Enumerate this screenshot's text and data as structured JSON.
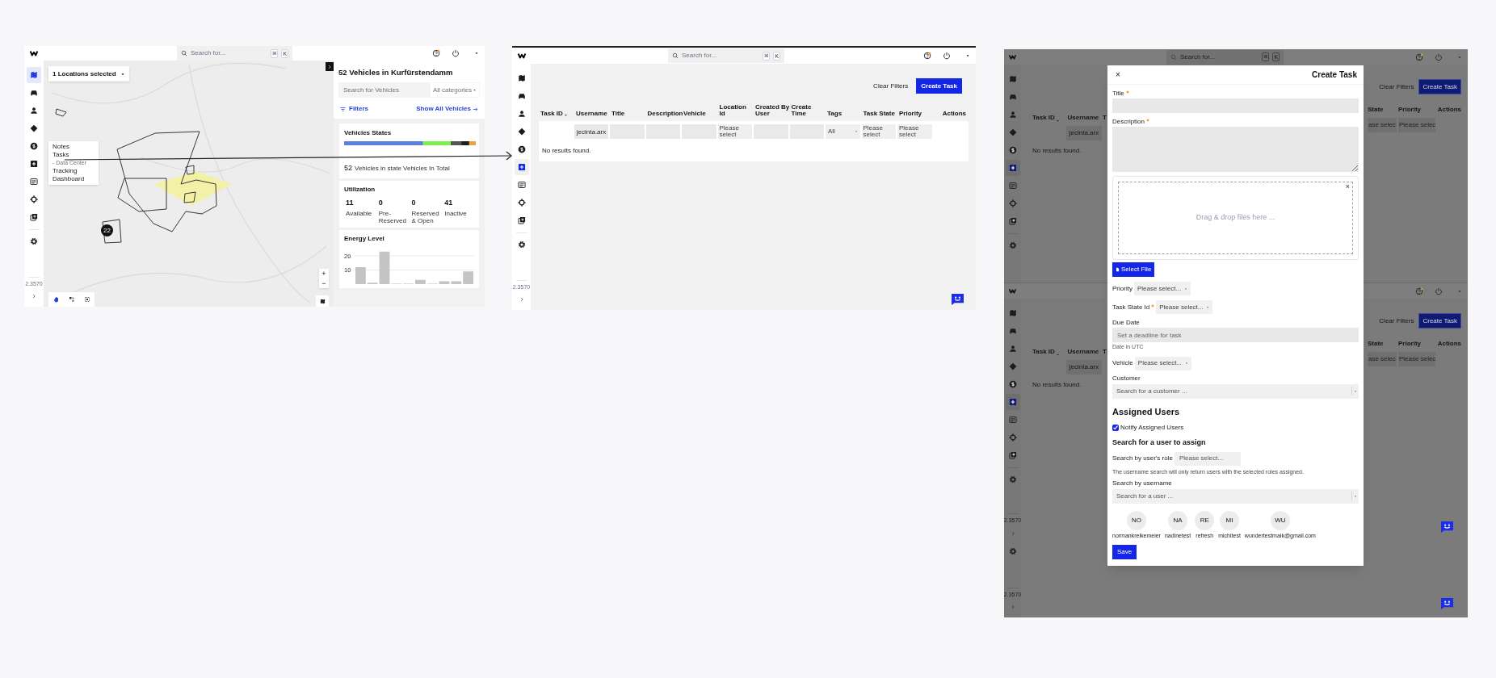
{
  "overview": {
    "header": {
      "search_placeholder": "Search for...",
      "shortcut": [
        "⌘",
        "K"
      ]
    },
    "nav": [
      {
        "selected": true
      },
      {
        "selected": false
      },
      {
        "selected": false
      },
      {
        "selected": false
      },
      {
        "selected": false
      },
      {
        "selected": false
      },
      {
        "selected": false
      },
      {
        "selected": false
      },
      {
        "selected": false
      }
    ],
    "version": "2.3570",
    "map": {
      "location_select": "1 Locations selected",
      "cluster": "22",
      "zoom_in": "+",
      "zoom_out": "−",
      "menu": [
        {
          "label": "Notes",
          "kind": "item"
        },
        {
          "label": "Tasks",
          "kind": "item"
        },
        {
          "label": "- Data Center",
          "kind": "sub"
        },
        {
          "label": "Tracking",
          "kind": "item"
        },
        {
          "label": "Dashboard",
          "kind": "item"
        }
      ]
    },
    "panel": {
      "title": "52 Vehicles in Kurfürstendamm",
      "search_placeholder": "Search for Vehicles",
      "category": "All categories",
      "filters": "Filters",
      "show_all": "Show All Vehicles",
      "states": {
        "title": "Vehicles States",
        "count": "52",
        "caption": "Vehicles in state Vehicles In Total"
      },
      "utilization": {
        "title": "Utilization",
        "stats": [
          {
            "value": "11",
            "label": "Available"
          },
          {
            "value": "0",
            "label": "Pre-Reserved"
          },
          {
            "value": "0",
            "label": "Reserved & Open"
          },
          {
            "value": "41",
            "label": "Inactive"
          }
        ]
      },
      "energy": {
        "chart_data": {
          "type": "bar",
          "title": "Energy Level",
          "values": [
            12,
            1,
            23,
            0,
            0,
            3,
            0,
            2,
            2,
            9
          ],
          "ylim": [
            0,
            24
          ],
          "yticks": [
            10,
            20
          ]
        }
      }
    }
  },
  "tasks": {
    "header": {
      "search_placeholder": "Search for...",
      "shortcut": [
        "⌘",
        "K"
      ]
    },
    "nav": [
      {
        "selected": false
      },
      {
        "selected": false
      },
      {
        "selected": false
      },
      {
        "selected": false
      },
      {
        "selected": false
      },
      {
        "selected": true
      },
      {
        "selected": false
      },
      {
        "selected": false
      },
      {
        "selected": false
      }
    ],
    "version": "2.3570",
    "buttons": {
      "clear": "Clear Filters",
      "create": "Create Task"
    },
    "columns": [
      {
        "label": "Task ID",
        "sorted": true
      },
      {
        "label": "Username",
        "sorted": false
      },
      {
        "label": "Title",
        "sorted": false
      },
      {
        "label": "Description",
        "sorted": false
      },
      {
        "label": "Vehicle",
        "sorted": false
      },
      {
        "label": "Location Id",
        "sorted": false
      },
      {
        "label": "Created By User",
        "sorted": false
      },
      {
        "label": "Create Time",
        "sorted": false
      },
      {
        "label": "Tags",
        "sorted": false
      },
      {
        "label": "Task State",
        "sorted": false
      },
      {
        "label": "Priority",
        "sorted": false
      },
      {
        "label": "Actions",
        "sorted": false
      }
    ],
    "filters": [
      {
        "kind": "none"
      },
      {
        "kind": "input",
        "value": "jecinta.arx"
      },
      {
        "kind": "input"
      },
      {
        "kind": "input"
      },
      {
        "kind": "input"
      },
      {
        "kind": "select",
        "placeholder": "Please select"
      },
      {
        "kind": "input"
      },
      {
        "kind": "input"
      },
      {
        "kind": "dropdown",
        "value": "All"
      },
      {
        "kind": "select",
        "placeholder": "Please select"
      },
      {
        "kind": "select",
        "placeholder": "Please select"
      },
      {
        "kind": "none"
      }
    ],
    "empty_text": "No results found."
  },
  "create_task": {
    "screens": [
      {
        "search_placeholder": "Search for...",
        "shortcut": [
          "⌘",
          "K"
        ],
        "nav": [
          {
            "selected": false
          },
          {
            "selected": false
          },
          {
            "selected": false
          },
          {
            "selected": false
          },
          {
            "selected": false
          },
          {
            "selected": true
          },
          {
            "selected": false
          },
          {
            "selected": false
          },
          {
            "selected": false
          }
        ],
        "buttons": {
          "clear": "Clear Filters",
          "create": "Create Task"
        },
        "left_columns": [
          {
            "label": "Task ID",
            "sorted": true
          },
          {
            "label": "Username",
            "sorted": false
          },
          {
            "label": "T",
            "sorted": false
          }
        ],
        "right_columns": [
          {
            "label": "State",
            "sorted": false
          },
          {
            "label": "Priority",
            "sorted": false
          },
          {
            "label": "Actions",
            "sorted": false
          }
        ],
        "left_cells": [
          "jecinta.arx"
        ],
        "right_cells": [
          "ase selec",
          "Please selec"
        ],
        "empty_text": "No results found."
      },
      {
        "nav": [
          {
            "selected": false
          },
          {
            "selected": false
          },
          {
            "selected": false
          },
          {
            "selected": false
          },
          {
            "selected": false
          },
          {
            "selected": true
          },
          {
            "selected": false
          },
          {
            "selected": false
          },
          {
            "selected": false
          }
        ],
        "versions": [
          "2.3570",
          "2.3570"
        ],
        "buttons": {
          "clear": "Clear Filters",
          "create": "Create Task"
        },
        "left_columns": [
          {
            "label": "Task ID",
            "sorted": true
          },
          {
            "label": "Username",
            "sorted": false
          },
          {
            "label": "T",
            "sorted": false
          }
        ],
        "right_columns": [
          {
            "label": "State",
            "sorted": false
          },
          {
            "label": "Priority",
            "sorted": false
          },
          {
            "label": "Actions",
            "sorted": false
          }
        ],
        "left_cells": [
          "jecinta.arx"
        ],
        "right_cells": [
          "ase selec",
          "Please selec"
        ],
        "empty_text": "No results found."
      }
    ],
    "modal": {
      "title": "Create Task",
      "close": "×",
      "items": [
        {
          "kind": "input",
          "label": "Title",
          "required": true
        },
        {
          "kind": "textarea",
          "label": "Description",
          "required": true
        },
        {
          "kind": "dropzone",
          "text": "Drag & drop files here ...",
          "close": "×"
        },
        {
          "kind": "file_button",
          "label": "Select File"
        },
        {
          "kind": "select",
          "label": "Priority",
          "required": false,
          "value": "Please select..."
        },
        {
          "kind": "select",
          "label": "Task State Id",
          "required": true,
          "value": "Please select..."
        },
        {
          "kind": "date",
          "label": "Due Date",
          "required": false,
          "placeholder": "Set a deadline for task",
          "hint": "Date in UTC"
        },
        {
          "kind": "select",
          "label": "Vehicle",
          "required": false,
          "value": "Please select..."
        },
        {
          "kind": "combobox",
          "label": "Customer",
          "placeholder": "Search for a customer ..."
        },
        {
          "kind": "heading",
          "text": "Assigned Users"
        },
        {
          "kind": "checkbox",
          "label": "Notify Assigned Users",
          "checked": true
        },
        {
          "kind": "subheading",
          "text": "Search for a user to assign"
        },
        {
          "kind": "picker",
          "label": "Search by user's role",
          "value": "Please select..."
        },
        {
          "kind": "note",
          "text": "The username search will only return users with the selected roles assigned."
        },
        {
          "kind": "combobox",
          "label": "Search by username",
          "placeholder": "Search for a user ..."
        },
        {
          "kind": "users",
          "users": [
            {
              "initials": "NO",
              "name": "normankreikemeier"
            },
            {
              "initials": "NA",
              "name": "nadinetest"
            },
            {
              "initials": "RE",
              "name": "refresh"
            },
            {
              "initials": "MI",
              "name": "michitest"
            },
            {
              "initials": "WU",
              "name": "wundertestmaik@gmail.com"
            }
          ]
        },
        {
          "kind": "save",
          "label": "Save"
        }
      ]
    }
  }
}
